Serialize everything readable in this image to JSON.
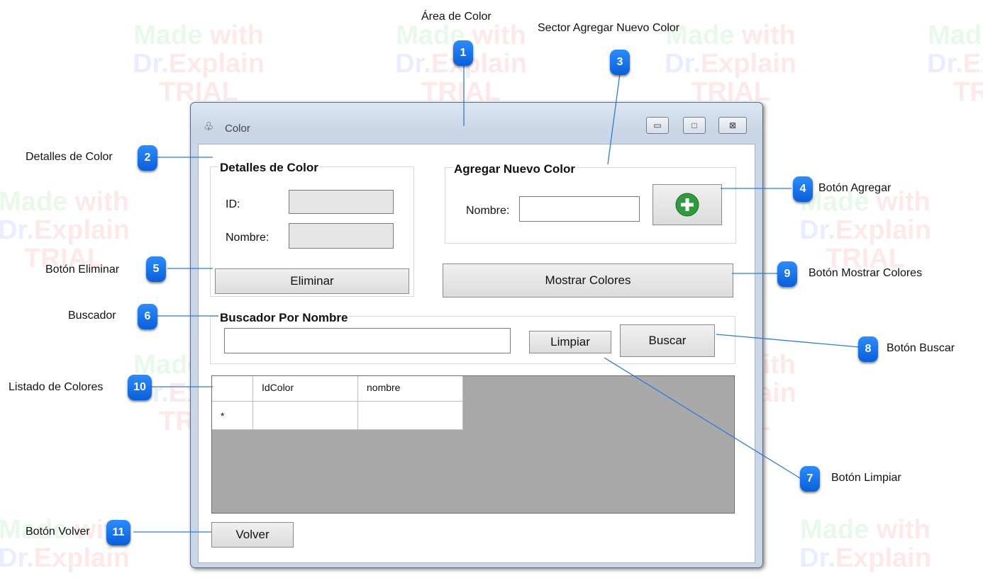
{
  "watermark": {
    "line1_a": "Made",
    "line1_b": "with",
    "line2_a": "Dr.",
    "line2_b": "Explain",
    "line3": "TRIAL"
  },
  "window": {
    "title": "Color",
    "minimize_glyph": "▭",
    "maximize_glyph": "□",
    "close_glyph": "⊠",
    "app_icon": "♧"
  },
  "details": {
    "group_label": "Detalles de Color",
    "id_label": "ID:",
    "id_value": "",
    "name_label": "Nombre:",
    "name_value": "",
    "delete_button": "Eliminar"
  },
  "add_color": {
    "group_label": "Agregar Nuevo Color",
    "name_label": "Nombre:",
    "name_value": "",
    "add_button_icon": "plus-circle-icon"
  },
  "show_colors_button": "Mostrar Colores",
  "search": {
    "group_label": "Buscador Por Nombre",
    "input_value": "",
    "clear_button": "Limpiar",
    "search_button": "Buscar"
  },
  "grid": {
    "columns": [
      "IdColor",
      "nombre"
    ],
    "new_row_marker": "*"
  },
  "back_button": "Volver",
  "callouts": [
    {
      "number": "1",
      "label": "Área de Color"
    },
    {
      "number": "2",
      "label": "Detalles de Color"
    },
    {
      "number": "3",
      "label": "Sector Agregar Nuevo Color"
    },
    {
      "number": "4",
      "label": "Botón Agregar"
    },
    {
      "number": "5",
      "label": "Botón Eliminar"
    },
    {
      "number": "6",
      "label": "Buscador"
    },
    {
      "number": "7",
      "label": "Botón Limpiar"
    },
    {
      "number": "8",
      "label": "Botón Buscar"
    },
    {
      "number": "9",
      "label": "Botón Mostrar Colores"
    },
    {
      "number": "10",
      "label": "Listado de Colores"
    },
    {
      "number": "11",
      "label": "Botón Volver"
    }
  ],
  "colors": {
    "badge": "#0a6fe8",
    "add_icon": "#2e9c3a",
    "grid_bg": "#a9a9a9"
  }
}
